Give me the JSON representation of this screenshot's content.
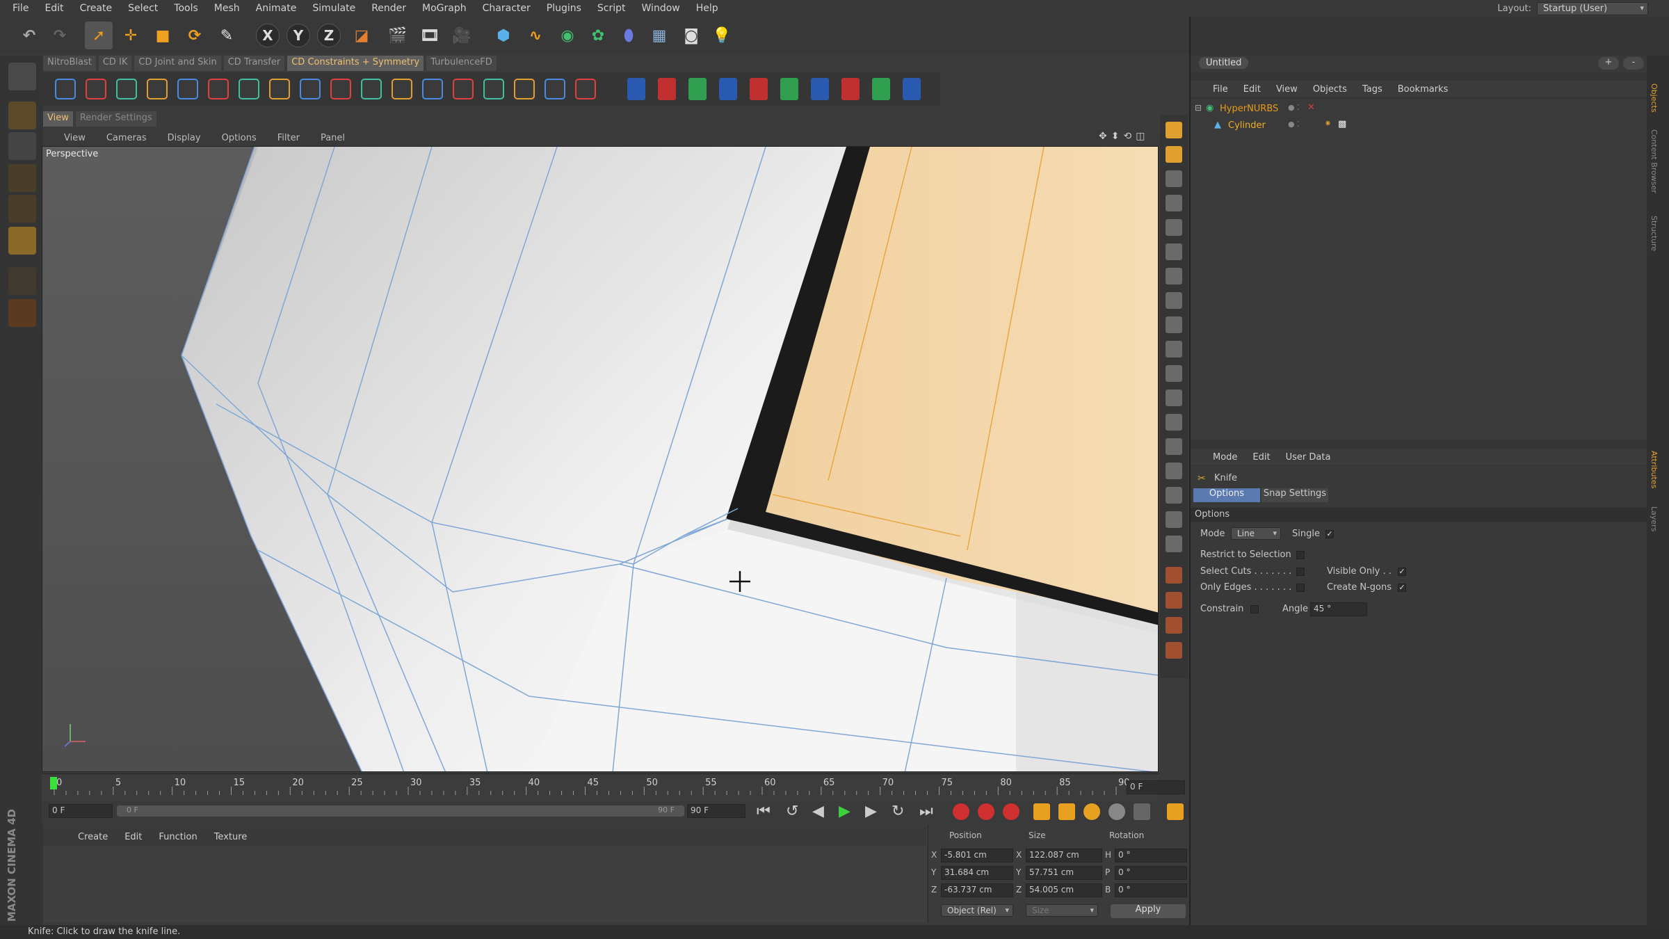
{
  "menu": [
    "File",
    "Edit",
    "Create",
    "Select",
    "Tools",
    "Mesh",
    "Animate",
    "Simulate",
    "Render",
    "MoGraph",
    "Character",
    "Plugins",
    "Script",
    "Window",
    "Help"
  ],
  "layout": {
    "label": "Layout:",
    "value": "Startup (User)"
  },
  "plugin_tabs": [
    "NitroBlast",
    "CD IK",
    "CD Joint and Skin",
    "CD Transfer",
    "CD Constraints + Symmetry",
    "TurbulenceFD"
  ],
  "plugin_tab_active": "CD Constraints + Symmetry",
  "axis_buttons": [
    "X",
    "Y",
    "Z"
  ],
  "view_tabs": {
    "view": "View",
    "render": "Render Settings"
  },
  "view_menu": [
    "View",
    "Cameras",
    "Display",
    "Options",
    "Filter",
    "Panel"
  ],
  "viewport": {
    "label": "Perspective"
  },
  "timeline": {
    "ticks": [
      "0",
      "5",
      "10",
      "15",
      "20",
      "25",
      "30",
      "35",
      "40",
      "45",
      "50",
      "55",
      "60",
      "65",
      "70",
      "75",
      "80",
      "85",
      "90"
    ],
    "current_frame": "0 F",
    "start_frame": "0 F",
    "range_start": "0 F",
    "range_end": "90 F",
    "end_frame": "90 F"
  },
  "material_menu": [
    "Create",
    "Edit",
    "Function",
    "Texture"
  ],
  "coordinates": {
    "headers": {
      "position": "Position",
      "size": "Size",
      "rotation": "Rotation"
    },
    "rows": [
      {
        "axis": "X",
        "pos": "-5.801 cm",
        "size_axis": "X",
        "size": "122.087 cm",
        "rot_axis": "H",
        "rot": "0 °"
      },
      {
        "axis": "Y",
        "pos": "31.684 cm",
        "size_axis": "Y",
        "size": "57.751 cm",
        "rot_axis": "P",
        "rot": "0 °"
      },
      {
        "axis": "Z",
        "pos": "-63.737 cm",
        "size_axis": "Z",
        "size": "54.005 cm",
        "rot_axis": "B",
        "rot": "0 °"
      }
    ],
    "mode": "Object (Rel)",
    "size_mode": "Size",
    "apply": "Apply"
  },
  "status": "Knife: Click to draw the knife line.",
  "brand": "MAXON CINEMA 4D",
  "object_manager": {
    "tab": "Untitled",
    "menu": [
      "File",
      "Edit",
      "View",
      "Objects",
      "Tags",
      "Bookmarks"
    ],
    "objects": [
      {
        "name": "HyperNURBS",
        "color": "#e89a1a"
      },
      {
        "name": "Cylinder",
        "color": "#f0b02a"
      }
    ]
  },
  "attributes": {
    "menu": [
      "Mode",
      "Edit",
      "User Data"
    ],
    "tool": "Knife",
    "tabs": [
      "Options",
      "Snap Settings"
    ],
    "section": "Options",
    "mode_label": "Mode",
    "mode_value": "Line",
    "single_label": "Single",
    "restrict": "Restrict to Selection",
    "select_cuts": "Select Cuts . . . . . . .",
    "visible_only": "Visible Only . .",
    "only_edges": "Only Edges . . . . . . .",
    "create_ngons": "Create N-gons",
    "constrain": "Constrain",
    "angle_label": "Angle",
    "angle_value": "45 °"
  },
  "side_tabs": [
    "Objects",
    "Content Browser",
    "Structure",
    "Attributes",
    "Layers"
  ],
  "colors": {
    "accent": "#f0c070",
    "face_selected": "#f4d6a4",
    "wire": "#7fa7d6",
    "bg": "#3b3b3b"
  }
}
